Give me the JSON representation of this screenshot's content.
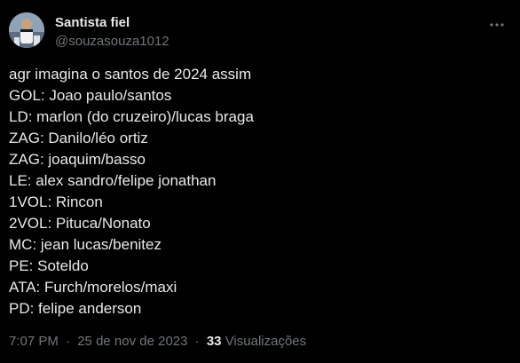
{
  "author": {
    "display_name": "Santista fiel",
    "handle": "@souzasouza1012",
    "avatar_icon": "avatar-photo"
  },
  "more_icon": "more-horizontal-icon",
  "tweet": {
    "lines": [
      "agr imagina o santos de 2024 assim",
      "GOL: Joao paulo/santos",
      "LD: marlon (do cruzeiro)/lucas braga",
      "ZAG: Danilo/léo ortiz",
      "ZAG: joaquim/basso",
      "LE: alex sandro/felipe jonathan",
      "1VOL: Rincon",
      "2VOL: Pituca/Nonato",
      "MC: jean lucas/benitez",
      "PE: Soteldo",
      "ATA: Furch/morelos/maxi",
      "PD: felipe anderson"
    ]
  },
  "meta": {
    "time": "7:07 PM",
    "separator": "·",
    "date": "25 de nov de 2023",
    "views_count": "33",
    "views_label": "Visualizações"
  },
  "colors": {
    "background": "#000000",
    "primary_text": "#e7e9ea",
    "secondary_text": "#71767b"
  }
}
